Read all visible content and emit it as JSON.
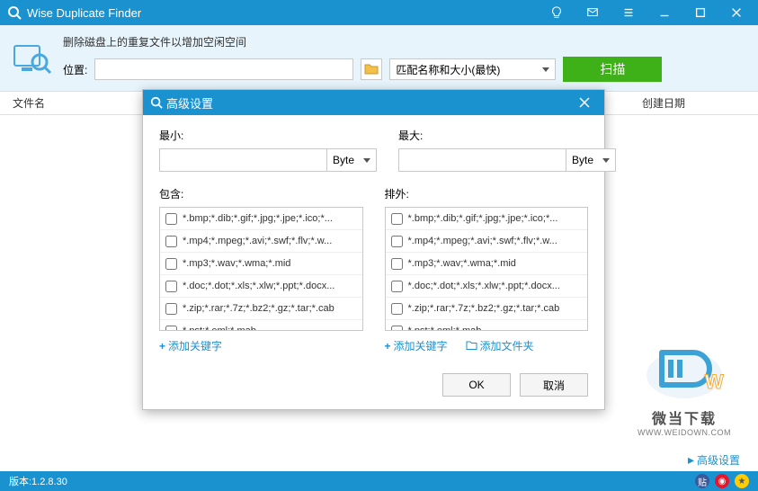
{
  "app": {
    "title": "Wise Duplicate Finder"
  },
  "toolbar": {
    "description": "删除磁盘上的重复文件以增加空闲空间",
    "location_label": "位置:",
    "location_value": "",
    "match_mode": "匹配名称和大小(最快)",
    "scan_label": "扫描"
  },
  "columns": {
    "filename": "文件名",
    "created": "创建日期"
  },
  "dialog": {
    "title": "高级设置",
    "min_label": "最小:",
    "max_label": "最大:",
    "min_value": "",
    "max_value": "",
    "unit": "Byte",
    "include_label": "包含:",
    "exclude_label": "排外:",
    "patterns": [
      "*.bmp;*.dib;*.gif;*.jpg;*.jpe;*.ico;*...",
      "*.mp4;*.mpeg;*.avi;*.swf;*.flv;*.w...",
      "*.mp3;*.wav;*.wma;*.mid",
      "*.doc;*.dot;*.xls;*.xlw;*.ppt;*.docx...",
      "*.zip;*.rar;*.7z;*.bz2;*.gz;*.tar;*.cab",
      "*.pst;*.eml;*.mab"
    ],
    "add_keyword": "添加关键字",
    "add_folder": "添加文件夹",
    "ok": "OK",
    "cancel": "取消"
  },
  "bottom_link": "高级设置",
  "status": {
    "version": "版本:1.2.8.30"
  },
  "watermark": {
    "text": "微当下载",
    "url": "WWW.WEIDOWN.COM"
  }
}
